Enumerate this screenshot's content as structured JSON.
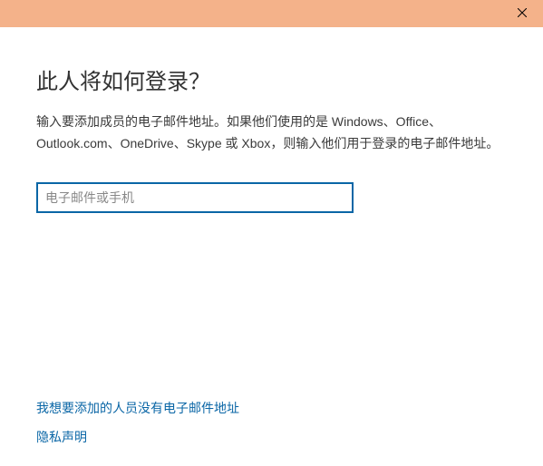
{
  "titlebar": {
    "close_icon": "close"
  },
  "heading": "此人将如何登录？",
  "description": "输入要添加成员的电子邮件地址。如果他们使用的是 Windows、Office、Outlook.com、OneDrive、Skype 或 Xbox，则输入他们用于登录的电子邮件地址。",
  "input": {
    "placeholder": "电子邮件或手机",
    "value": ""
  },
  "links": {
    "no_email": "我想要添加的人员没有电子邮件地址",
    "privacy": "隐私声明"
  }
}
